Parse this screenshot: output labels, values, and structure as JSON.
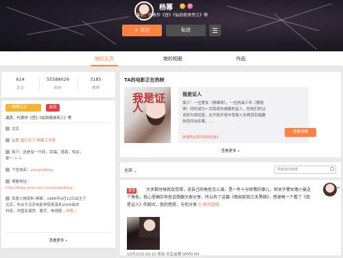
{
  "profile": {
    "name": "杨幂",
    "badge_v": "V",
    "gender_icon": "female-icon",
    "desc": "演员，代表作《宫》《仙剑奇侠传三》等",
    "follow_label": "+ 关注",
    "message_label": "私信",
    "menu_icon": "menu-icon"
  },
  "tabs": [
    {
      "label": "她的主页",
      "active": true
    },
    {
      "label": "她的相册",
      "active": false
    },
    {
      "label": "作品",
      "active": false
    }
  ],
  "stats": [
    {
      "value": "614",
      "label": "关注"
    },
    {
      "value": "55588026",
      "label": "粉丝"
    },
    {
      "value": "3185",
      "label": "微博"
    }
  ],
  "sidebar": {
    "verify_label": "微博认证",
    "vip_label": "会员",
    "role": "演员，代表作《宫》《仙剑奇侠传三》等",
    "location": "北京",
    "company_prefix": "公司",
    "company": "嘉行天下  杨幂工作室",
    "intro_1": "简介：这是有一只妖",
    "intro_2": "，幸福，感恩，知足，",
    "intro_3": "爱～ > <",
    "domain_prefix": "个性域名：",
    "domain": "yangmiblog",
    "blog_prefix": "博客地址：",
    "blog": "http://blog.sina.com.cn/yangmiblog",
    "baike_1": "百度人物资料  杨幂，1986年9月12日出生于",
    "baike_2": "北京，毕业于北京电影学院表演系2005级本",
    "baike_3": "科班，中国女演员、歌手、电视剧...",
    "baike_more": "详情 »",
    "more": "查看更多 »"
  },
  "movie": {
    "section_title": "TA的电影正在热映",
    "poster_title": "我是证人",
    "name": "我是证人",
    "desc": "简介：一位警女（杨幂饰），一位热血少年（鹿晗饰）同时成为一宗雨夜车祸案的证人，但他们的证词却大相径庭，在不知不觉中竟卷入车祸背后暗藏的连环凶杀案，...",
    "link": "微博热议榜日前排名第1",
    "detail_button": "查看详情",
    "more": "查看更多 »"
  },
  "feed": {
    "filter_label": "全部",
    "search_placeholder": "搜索她的微博"
  },
  "post": {
    "tag": "置顶",
    "text": "大多数时候我会觉得，说自己的角色怎么演，是一件十分矫情的事儿，但关于警女路小曼这个角色，我心里确实有些话想跟大家分享，所以有了这篇《假如给我三天黑暗》，感谢每一个看了《我是证人》的观众，我的感受，与你分享",
    "link_label": "网页链接",
    "meta": "10月31日 00:12 来自 天生会睡 OPPO N3"
  },
  "colors": {
    "accent": "#ff8140",
    "dark_bg": "#1f1c27",
    "link": "#eb7350",
    "vip": "#e64141"
  }
}
